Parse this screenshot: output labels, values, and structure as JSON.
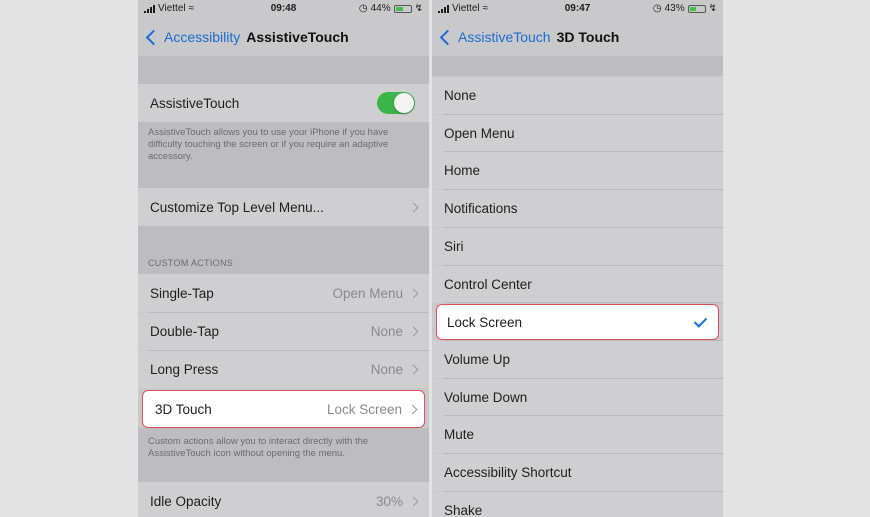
{
  "left": {
    "status": {
      "carrier": "Viettel",
      "time": "09:48",
      "battery": "44%",
      "battery_level": 0.44
    },
    "nav": {
      "back": "Accessibility",
      "title": "AssistiveTouch"
    },
    "assistive": {
      "label": "AssistiveTouch",
      "on": true
    },
    "assistive_footer": "AssistiveTouch allows you to use your iPhone if you have difficulty touching the screen or if you require an adaptive accessory.",
    "customize": "Customize Top Level Menu...",
    "custom_header": "CUSTOM ACTIONS",
    "actions": [
      {
        "label": "Single-Tap",
        "value": "Open Menu"
      },
      {
        "label": "Double-Tap",
        "value": "None"
      },
      {
        "label": "Long Press",
        "value": "None"
      },
      {
        "label": "3D Touch",
        "value": "Lock Screen"
      }
    ],
    "custom_footer": "Custom actions allow you to interact directly with the AssistiveTouch icon without opening the menu.",
    "idle": {
      "label": "Idle Opacity",
      "value": "30%"
    }
  },
  "right": {
    "status": {
      "carrier": "Viettel",
      "time": "09:47",
      "battery": "43%",
      "battery_level": 0.43
    },
    "nav": {
      "back": "AssistiveTouch",
      "title": "3D Touch"
    },
    "options": [
      "None",
      "Open Menu",
      "Home",
      "Notifications",
      "Siri",
      "Control Center",
      "Lock Screen",
      "Volume Up",
      "Volume Down",
      "Mute",
      "Accessibility Shortcut",
      "Shake"
    ],
    "selected": "Lock Screen"
  },
  "colors": {
    "accent": "#1a6bd6",
    "toggle": "#3bb54a",
    "highlight_border": "#e0505a"
  }
}
